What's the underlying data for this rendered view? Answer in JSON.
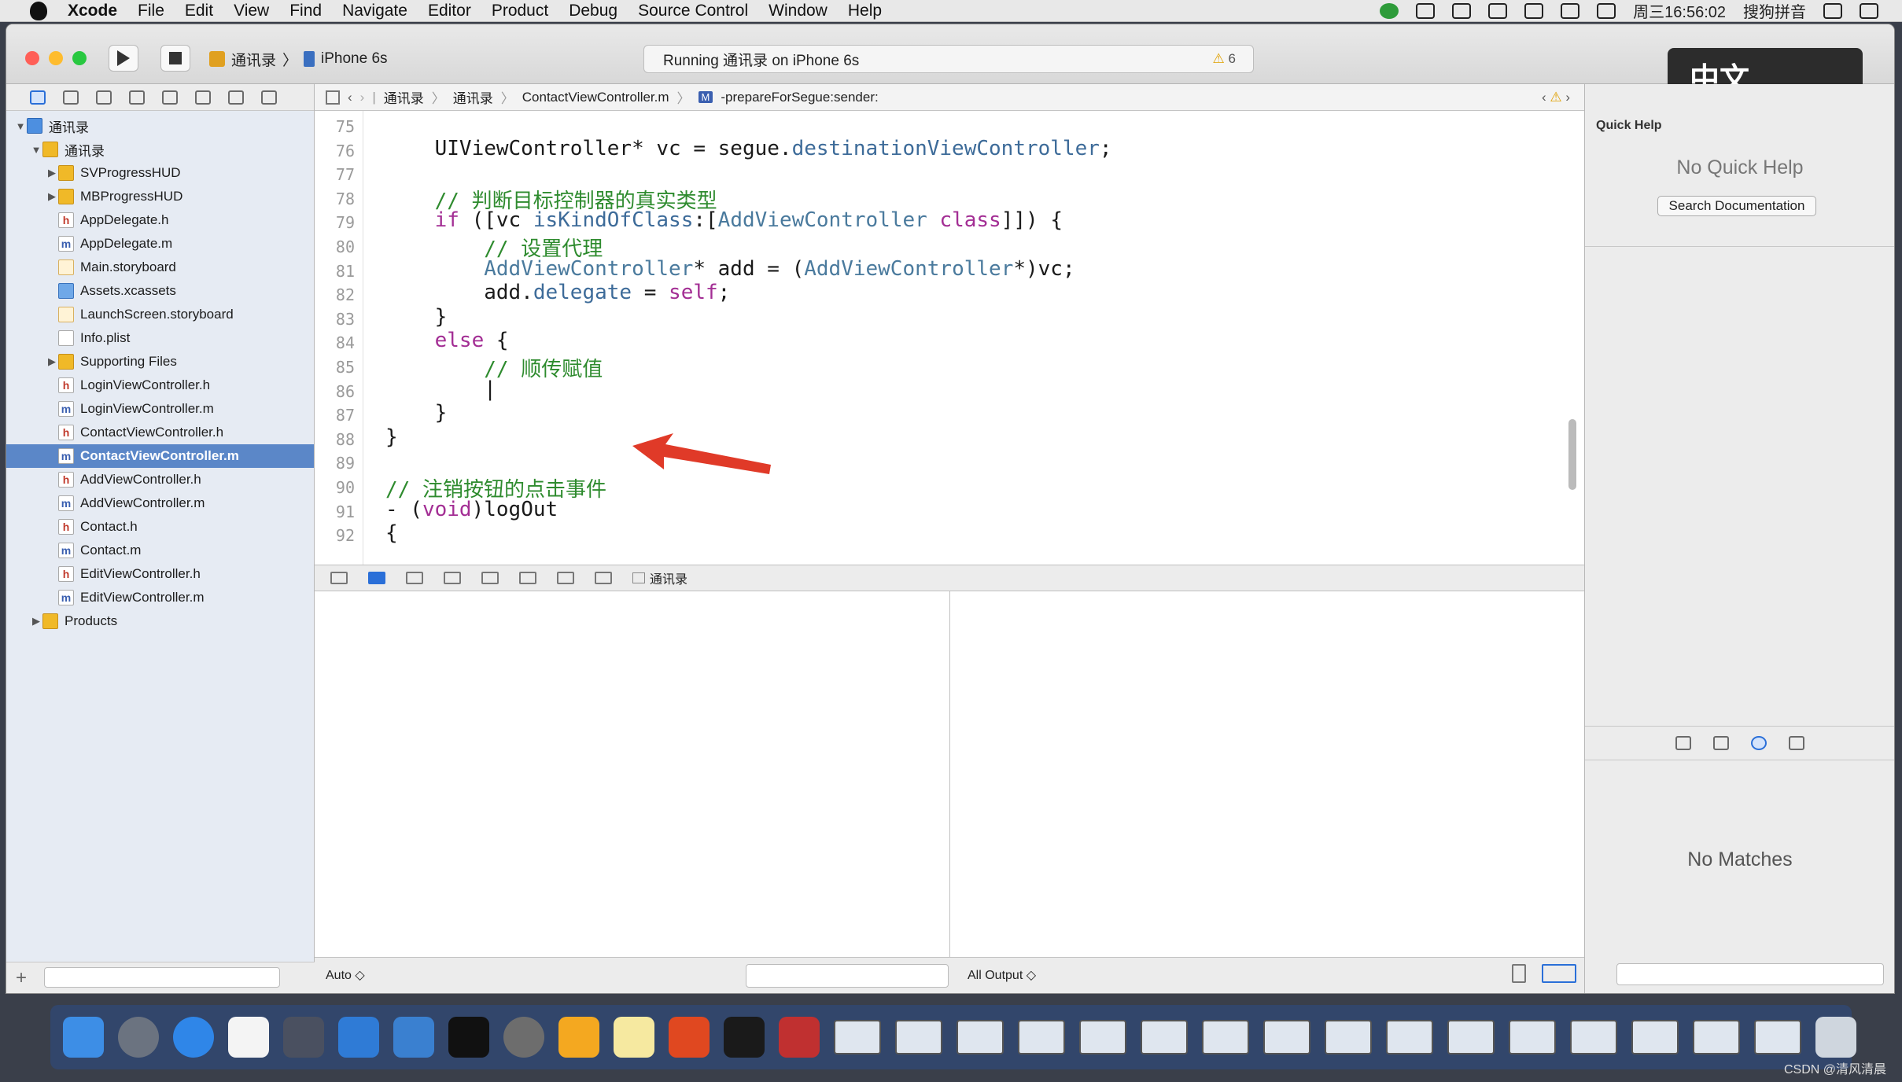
{
  "menubar": {
    "app_name": "Xcode",
    "items": [
      "File",
      "Edit",
      "View",
      "Find",
      "Navigate",
      "Editor",
      "Product",
      "Debug",
      "Source Control",
      "Window",
      "Help"
    ],
    "clock": "周三16:56:02",
    "ime_label": "搜狗拼音"
  },
  "toolbar": {
    "scheme": "通讯录",
    "device": "iPhone 6s",
    "status": "Running 通讯录 on iPhone 6s",
    "warnings": "6",
    "ime_popup": "中文",
    "traffic_colors": [
      "#ff5f57",
      "#febc2e",
      "#28c840"
    ]
  },
  "navigator": {
    "files": [
      {
        "label": "通讯录",
        "kind": "project",
        "level": 0,
        "expanded": true
      },
      {
        "label": "通讯录",
        "kind": "folder",
        "level": 1,
        "expanded": true
      },
      {
        "label": "SVProgressHUD",
        "kind": "folder",
        "level": 2,
        "expanded": false
      },
      {
        "label": "MBProgressHUD",
        "kind": "folder",
        "level": 2,
        "expanded": false
      },
      {
        "label": "AppDelegate.h",
        "kind": "h",
        "level": 2
      },
      {
        "label": "AppDelegate.m",
        "kind": "m",
        "level": 2
      },
      {
        "label": "Main.storyboard",
        "kind": "storyboard",
        "level": 2
      },
      {
        "label": "Assets.xcassets",
        "kind": "assets",
        "level": 2
      },
      {
        "label": "LaunchScreen.storyboard",
        "kind": "storyboard",
        "level": 2
      },
      {
        "label": "Info.plist",
        "kind": "plist",
        "level": 2
      },
      {
        "label": "Supporting Files",
        "kind": "folder",
        "level": 2,
        "expanded": false
      },
      {
        "label": "LoginViewController.h",
        "kind": "h",
        "level": 2
      },
      {
        "label": "LoginViewController.m",
        "kind": "m",
        "level": 2
      },
      {
        "label": "ContactViewController.h",
        "kind": "h",
        "level": 2
      },
      {
        "label": "ContactViewController.m",
        "kind": "m",
        "level": 2,
        "selected": true
      },
      {
        "label": "AddViewController.h",
        "kind": "h",
        "level": 2
      },
      {
        "label": "AddViewController.m",
        "kind": "m",
        "level": 2
      },
      {
        "label": "Contact.h",
        "kind": "h",
        "level": 2
      },
      {
        "label": "Contact.m",
        "kind": "m",
        "level": 2
      },
      {
        "label": "EditViewController.h",
        "kind": "h",
        "level": 2
      },
      {
        "label": "EditViewController.m",
        "kind": "m",
        "level": 2
      },
      {
        "label": "Products",
        "kind": "folder",
        "level": 1,
        "expanded": false
      }
    ]
  },
  "jumpbar": {
    "crumbs": [
      "通讯录",
      "通讯录",
      "ContactViewController.m",
      "-prepareForSegue:sender:"
    ]
  },
  "editor": {
    "lines": [
      {
        "n": "75",
        "html": ""
      },
      {
        "n": "76",
        "html": "    UIViewController* vc = segue.<span class=\"mth\">destinationViewController</span>;"
      },
      {
        "n": "77",
        "html": ""
      },
      {
        "n": "78",
        "html": "    <span class=\"cm\">// 判断目标控制器的真实类型</span>"
      },
      {
        "n": "79",
        "html": "    <span class=\"kw\">if</span> ([vc <span class=\"mth\">isKindOfClass</span>:[<span class=\"cls\">AddViewController</span> <span class=\"kw\">class</span>]]) {"
      },
      {
        "n": "80",
        "html": "        <span class=\"cm\">// 设置代理</span>"
      },
      {
        "n": "81",
        "html": "        <span class=\"cls\">AddViewController</span>* add = (<span class=\"cls\">AddViewController</span>*)vc;"
      },
      {
        "n": "82",
        "html": "        add.<span class=\"mth\">delegate</span> = <span class=\"kw\">self</span>;"
      },
      {
        "n": "83",
        "html": "    }"
      },
      {
        "n": "84",
        "html": "    <span class=\"kw\">else</span> {"
      },
      {
        "n": "85",
        "html": "        <span class=\"cm\">// 顺传赋值</span>"
      },
      {
        "n": "86",
        "html": "        |"
      },
      {
        "n": "87",
        "html": "    }"
      },
      {
        "n": "88",
        "html": "}"
      },
      {
        "n": "89",
        "html": ""
      },
      {
        "n": "90",
        "html": "<span class=\"cm\">// 注销按钮的点击事件</span>"
      },
      {
        "n": "91",
        "html": "- (<span class=\"kw\">void</span>)logOut"
      },
      {
        "n": "92",
        "html": "{"
      }
    ]
  },
  "debug": {
    "target": "通讯录",
    "var_mode": "Auto ◇",
    "output_mode": "All Output ◇"
  },
  "inspector": {
    "title": "Quick Help",
    "no_help": "No Quick Help",
    "search_button": "Search Documentation",
    "no_matches": "No Matches"
  },
  "watermark": "CSDN @清风清晨"
}
